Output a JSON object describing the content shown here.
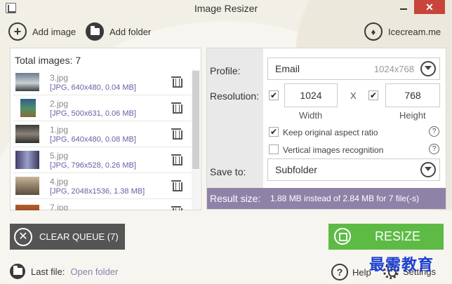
{
  "window": {
    "title": "Image Resizer",
    "close_glyph": "✕"
  },
  "toolbar": {
    "add_image": "Add image",
    "add_folder": "Add folder",
    "brand": "Icecream.me"
  },
  "list": {
    "total_label": "Total images: 7",
    "items": [
      {
        "name": "3.jpg",
        "info": "[JPG, 640x480, 0.04 MB]"
      },
      {
        "name": "2.jpg",
        "info": "[JPG, 500x631, 0.06 MB]"
      },
      {
        "name": "1.jpg",
        "info": "[JPG, 640x480, 0.08 MB]"
      },
      {
        "name": "5.jpg",
        "info": "[JPG, 796x528, 0.26 MB]"
      },
      {
        "name": "4.jpg",
        "info": "[JPG, 2048x1536, 1.38 MB]"
      },
      {
        "name": "7.jpg",
        "info": ""
      }
    ]
  },
  "settings": {
    "profile_label": "Profile:",
    "profile_value": "Email",
    "profile_dims": "1024x768",
    "resolution_label": "Resolution:",
    "width_value": "1024",
    "height_value": "768",
    "x_sep": "X",
    "width_label": "Width",
    "height_label": "Height",
    "keep_aspect": "Keep original aspect ratio",
    "vertical_recognition": "Vertical images recognition",
    "save_to_label": "Save to:",
    "save_to_value": "Subfolder",
    "help_glyph": "?",
    "check_glyph": "✔"
  },
  "result": {
    "label": "Result size:",
    "text": "1.88 MB instead of 2.84 MB for 7 file(-s)"
  },
  "actions": {
    "clear_queue": "CLEAR QUEUE (7)",
    "resize": "RESIZE",
    "clear_glyph": "✕"
  },
  "footer": {
    "last_file": "Last file:",
    "open_folder": "Open folder",
    "help": "Help",
    "settings": "Settings",
    "help_glyph": "?"
  },
  "watermark": "最需教育",
  "colors": {
    "accent_purple": "#8f82a9",
    "resize_green": "#5dbb45",
    "close_red": "#c7453a",
    "clear_gray": "#555555"
  }
}
